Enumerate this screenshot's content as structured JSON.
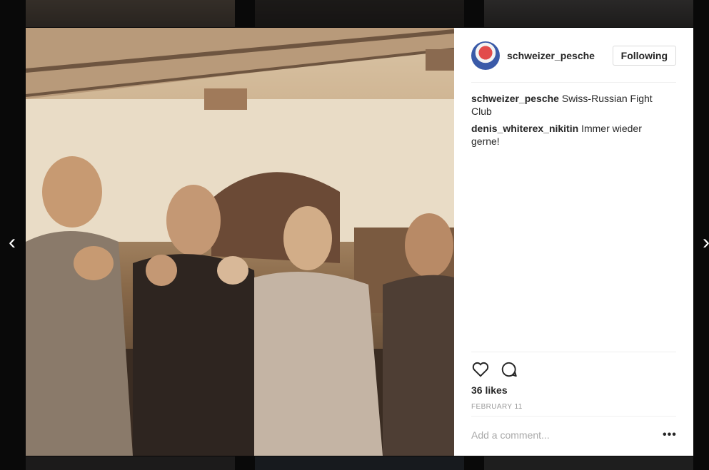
{
  "post": {
    "username": "schweizer_pesche",
    "follow_label": "Following",
    "comments": [
      {
        "user": "schweizer_pesche",
        "text": "Swiss-Russian Fight Club"
      },
      {
        "user": "denis_whiterex_nikitin",
        "text": "Immer wieder gerne!"
      }
    ],
    "likes": "36 likes",
    "date": "FEBRUARY 11",
    "comment_placeholder": "Add a comment...",
    "more_label": "•••"
  },
  "nav": {
    "prev_label": "‹",
    "next_label": "›"
  },
  "icons": {
    "like": "heart-icon",
    "comment": "comment-icon",
    "prev": "chevron-left-icon",
    "next": "chevron-right-icon"
  }
}
